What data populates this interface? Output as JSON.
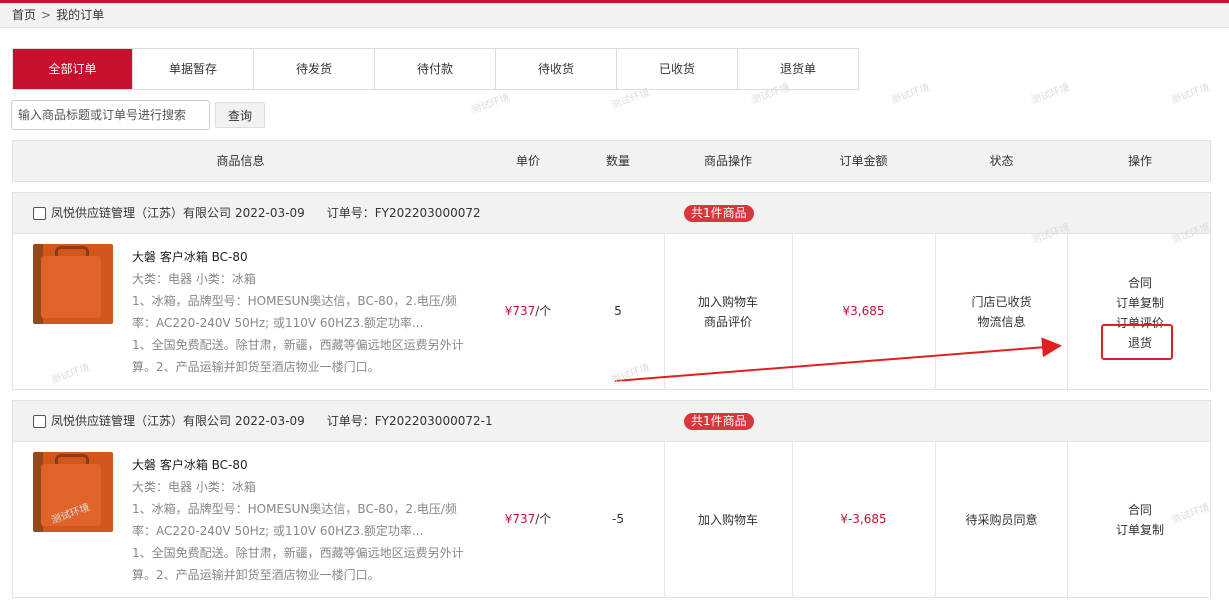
{
  "breadcrumb": {
    "home": "首页",
    "separator": ">",
    "current": "我的订单"
  },
  "tabs": [
    "全部订单",
    "单据暂存",
    "待发货",
    "待付款",
    "待收货",
    "已收货",
    "退货单"
  ],
  "search": {
    "placeholder": "输入商品标题或订单号进行搜索",
    "button": "查询"
  },
  "header": {
    "product": "商品信息",
    "price": "单价",
    "qty": "数量",
    "product_ops": "商品操作",
    "amount": "订单金额",
    "status": "状态",
    "ops": "操作"
  },
  "watermark": "测试环境",
  "orders": [
    {
      "company": "凤悦供应链管理（江苏）有限公司",
      "date": "2022-03-09",
      "order_no": "订单号：FY202203000072",
      "badge": "共1件商品",
      "product_name": "大磐 客户冰箱 BC-80",
      "category": "大类：电器 小类：冰箱",
      "spec": "1、冰箱，品牌型号：HOMESUN奥达信，BC-80，2.电压/频率：AC220-240V 50Hz; 或110V 60HZ3.额定功率...",
      "note": "1、全国免费配送。除甘肃，新疆，西藏等偏远地区运费另外计算。2、产品运输并卸货至酒店物业一楼门口。",
      "price": "¥737",
      "unit": "/个",
      "qty": "5",
      "product_ops": [
        "加入购物车",
        "商品评价"
      ],
      "amount": "¥3,685",
      "status": [
        "门店已收货",
        "物流信息"
      ],
      "actions": [
        "合同",
        "订单复制",
        "订单评价",
        "退货"
      ]
    },
    {
      "company": "凤悦供应链管理（江苏）有限公司",
      "date": "2022-03-09",
      "order_no": "订单号：FY202203000072-1",
      "badge": "共1件商品",
      "product_name": "大磐 客户冰箱 BC-80",
      "category": "大类：电器 小类：冰箱",
      "spec": "1、冰箱，品牌型号：HOMESUN奥达信，BC-80，2.电压/频率：AC220-240V 50Hz; 或110V 60HZ3.额定功率...",
      "note": "1、全国免费配送。除甘肃，新疆，西藏等偏远地区运费另外计算。2、产品运输并卸货至酒店物业一楼门口。",
      "price": "¥737",
      "unit": "/个",
      "qty": "-5",
      "product_ops": [
        "加入购物车"
      ],
      "amount": "¥-3,685",
      "status": [
        "待采购员同意"
      ],
      "actions": [
        "合同",
        "订单复制"
      ]
    }
  ],
  "colors": {
    "brand": "#c8102e",
    "badge": "#d9363e",
    "annotation": "#e02020"
  }
}
